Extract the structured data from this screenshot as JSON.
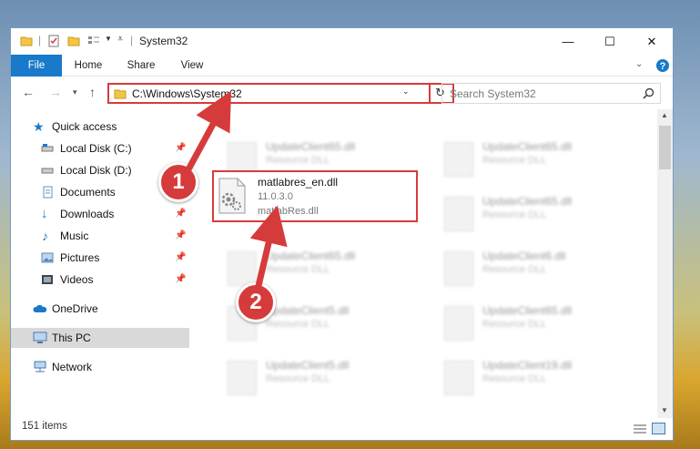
{
  "window": {
    "title": "System32"
  },
  "window_controls": {
    "minimize": "—",
    "maximize": "☐",
    "close": "✕"
  },
  "ribbon": {
    "tabs": [
      "File",
      "Home",
      "Share",
      "View"
    ]
  },
  "navigation": {
    "address": "C:\\Windows\\System32",
    "search_placeholder": "Search System32"
  },
  "sidebar": {
    "items": [
      {
        "label": "Quick access",
        "icon": "star-icon"
      },
      {
        "label": "Local Disk (C:)",
        "icon": "drive-icon",
        "pinned": true
      },
      {
        "label": "Local Disk (D:)",
        "icon": "drive-icon",
        "pinned": true
      },
      {
        "label": "Documents",
        "icon": "documents-icon",
        "pinned": true
      },
      {
        "label": "Downloads",
        "icon": "downloads-icon",
        "pinned": true
      },
      {
        "label": "Music",
        "icon": "music-icon",
        "pinned": true
      },
      {
        "label": "Pictures",
        "icon": "pictures-icon",
        "pinned": true
      },
      {
        "label": "Videos",
        "icon": "videos-icon",
        "pinned": true
      },
      {
        "label": "OneDrive",
        "icon": "onedrive-icon"
      },
      {
        "label": "This PC",
        "icon": "computer-icon",
        "selected": true
      },
      {
        "label": "Network",
        "icon": "network-icon"
      }
    ]
  },
  "files": {
    "highlighted": {
      "name": "matlabres_en.dll",
      "version": "11.0.3.0",
      "description": "matlabRes.dll"
    },
    "blurred": [
      {
        "name": "UpdateClient65.dll",
        "description": "Resource DLL"
      },
      {
        "name": "UpdateClient65.dll",
        "description": "Resource DLL"
      },
      {
        "name": "UpdateClient65.dll",
        "description": "Resource DLL"
      },
      {
        "name": "UpdateClient6.dll",
        "description": "Resource DLL"
      },
      {
        "name": "UpdateClient65.dll",
        "description": "Resource DLL"
      },
      {
        "name": "UpdateClient5.dll",
        "description": "Resource DLL"
      },
      {
        "name": "UpdateClient65.dll",
        "description": "Resource DLL"
      },
      {
        "name": "UpdateClient5.dll",
        "description": "Resource DLL"
      },
      {
        "name": "UpdateClient19.dll",
        "description": "Resource DLL"
      }
    ]
  },
  "status": {
    "item_count": "151 items"
  },
  "annotations": {
    "step1": "1",
    "step2": "2"
  },
  "colors": {
    "accent": "#1979ca",
    "highlight_red": "#d93b3b"
  }
}
